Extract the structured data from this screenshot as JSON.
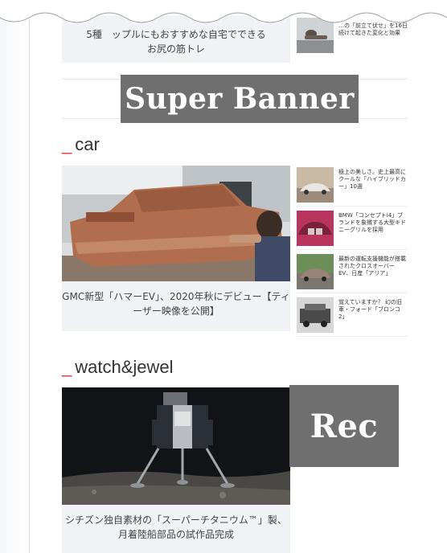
{
  "top": {
    "card_text_line1": "5種　ップルにもおすすめな自宅でできる",
    "card_text_line2": "お尻の筋トレ",
    "side_text": "…の「前立て伏せ」を16日続けて起きた変化と効果"
  },
  "ads": {
    "super_banner": "Super Banner",
    "rec": "Rec"
  },
  "sections": {
    "car": {
      "dash": "_",
      "title": "car",
      "hero_caption": "GMC新型「ハマーEV」、2020年秋にデビュー【ティーザー映像を公開】",
      "side_items": [
        {
          "text": "極上の美しさ。史上最高にクールな「ハイブリッドカー」10選"
        },
        {
          "text": "BMW「コンセプトi4」ブランドを象徴する大型キドニーグリルを採用"
        },
        {
          "text": "最新の運転支援機能が搭載されたクロスオーバーEV、日産「アリア」"
        },
        {
          "text": "覚えていますか？ 幻の旧車・フォード「ブロンコ2」"
        }
      ]
    },
    "watch": {
      "dash": "_",
      "title": "watch&jewel",
      "hero_caption": "シチズン独自素材の「スーパーチタニウム™」製、月着陸船部品の試作品完成"
    }
  },
  "icons": [
    "car-thumbnail",
    "lunar-lander-image"
  ],
  "colors": {
    "accent": "#e23a3a",
    "ad_placeholder": "#6f6f6f",
    "caption_bg": "#f1f2f5"
  }
}
